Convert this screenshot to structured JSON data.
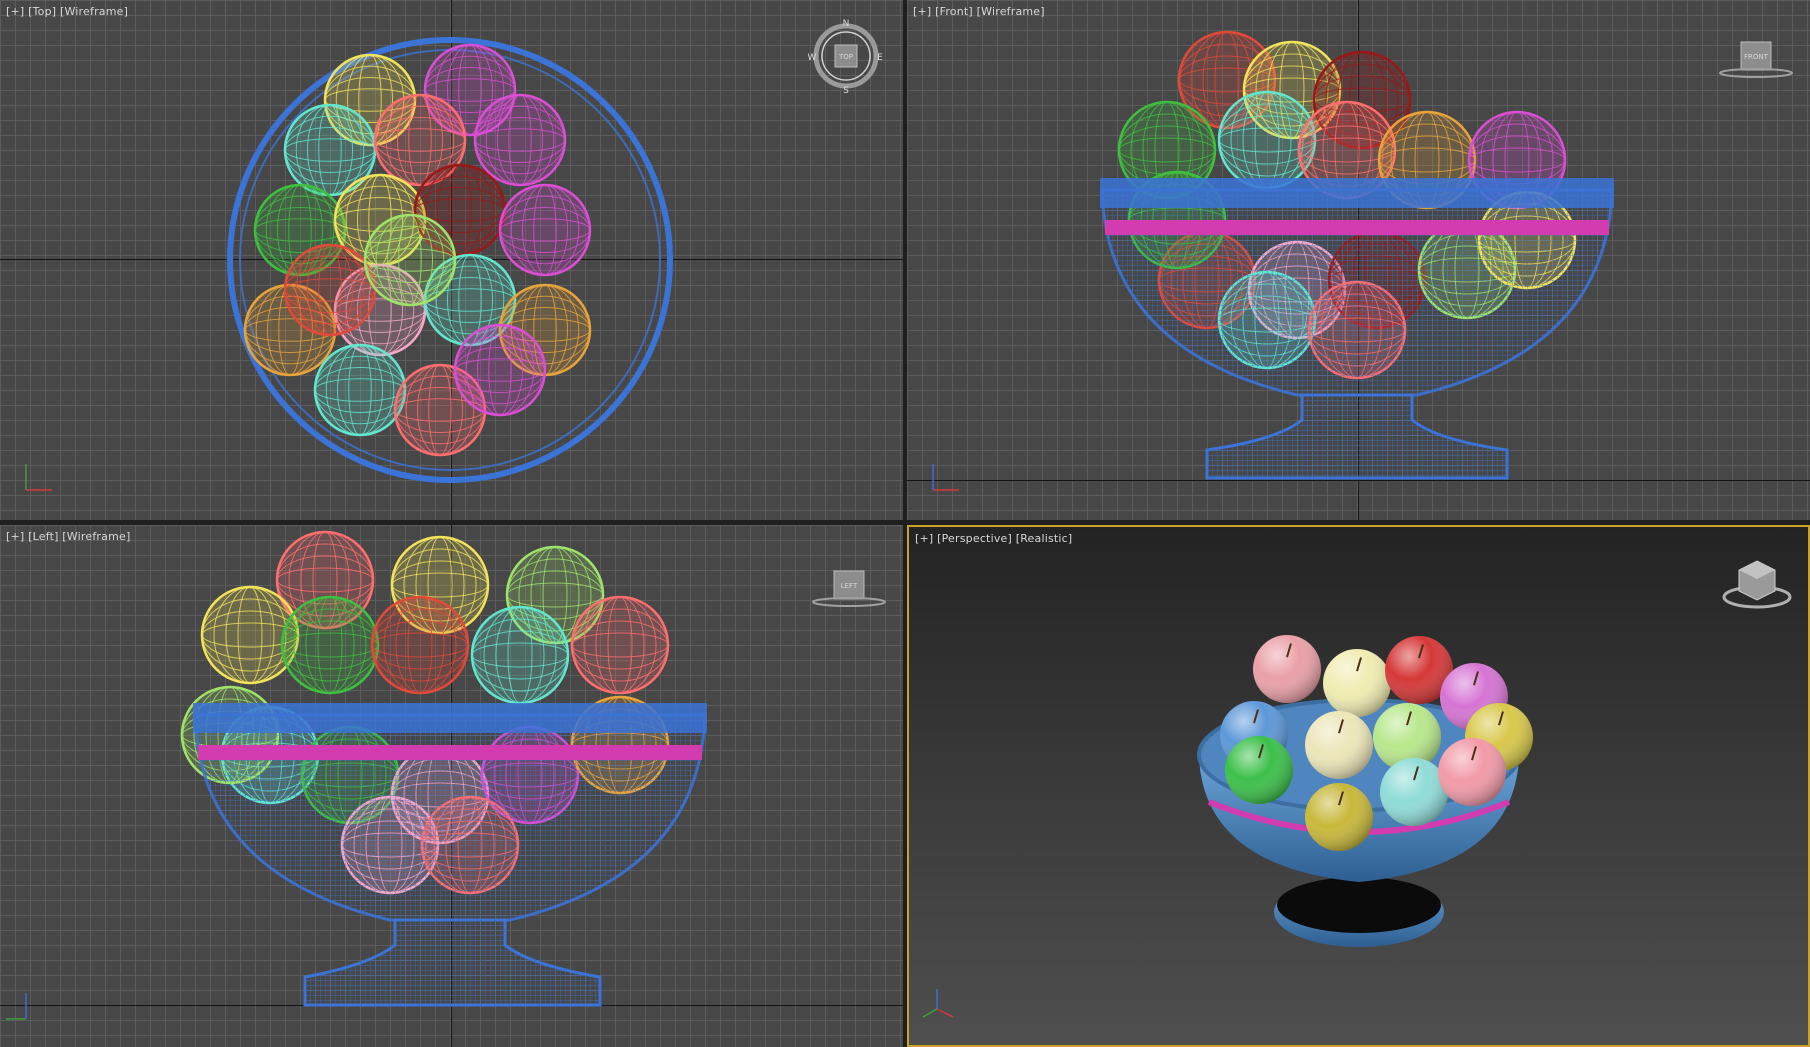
{
  "viewports": [
    {
      "id": "top",
      "plus": "[+]",
      "view": "[Top]",
      "shading": "[Wireframe]",
      "cube_label": "TOP",
      "compass": {
        "n": "N",
        "s": "S",
        "e": "E",
        "w": "W"
      }
    },
    {
      "id": "front",
      "plus": "[+]",
      "view": "[Front]",
      "shading": "[Wireframe]",
      "cube_label": "FRONT"
    },
    {
      "id": "left",
      "plus": "[+]",
      "view": "[Left]",
      "shading": "[Wireframe]",
      "cube_label": "LEFT"
    },
    {
      "id": "perspective",
      "plus": "[+]",
      "view": "[Perspective]",
      "shading": "[Realistic]"
    }
  ],
  "gizmo_axes": {
    "x": "x",
    "y": "y",
    "z": "z"
  },
  "colors": {
    "grid_bg": "#474747",
    "grid_line": "#5f5f5f",
    "axis_line": "#151515",
    "bowl_blue": "#3b73d6",
    "bowl_stripe_magenta": "#d23cb0",
    "active_border": "#c9a227",
    "apple_colors": [
      "#f2e35a",
      "#3fbf3f",
      "#e14a3a",
      "#d94fd4",
      "#63e6d0",
      "#9a1818",
      "#e8a43a",
      "#f6a8c8",
      "#9fe36a",
      "#ff6e6e"
    ]
  }
}
